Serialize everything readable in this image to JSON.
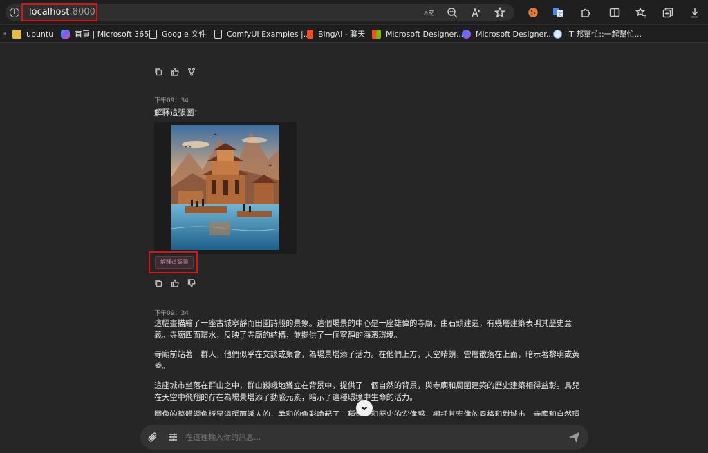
{
  "address_bar": {
    "host": "localhost",
    "port": ":8000"
  },
  "bookmarks": [
    {
      "label": "ubuntu",
      "icon": "folder-icon",
      "color": "#e8b84a"
    },
    {
      "label": "首頁 | Microsoft 365",
      "icon": "m365-icon",
      "color": "#7b5cf0"
    },
    {
      "label": "Google 文件",
      "icon": "page-icon",
      "color": "#d8d8d8"
    },
    {
      "label": "ComfyUI Examples |...",
      "icon": "page-icon",
      "color": "#d8d8d8"
    },
    {
      "label": "BingAI - 聊天",
      "icon": "bing-icon",
      "color": "#f25022"
    },
    {
      "label": "Microsoft Designer...",
      "icon": "microsoft-icon",
      "color": "#7fba00"
    },
    {
      "label": "Microsoft Designer...",
      "icon": "designer-icon",
      "color": "#9b59f5"
    },
    {
      "label": "iT 邦幫忙::一起幫忙...",
      "icon": "ithome-icon",
      "color": "#5aa0e6"
    }
  ],
  "chat": {
    "user_time": "下午09：34",
    "user_message": "解釋這張圖：",
    "image_tag": "解釋這張圖",
    "ai_time": "下午09：34",
    "ai_paragraphs": [
      "這幅畫描繪了一座古城寧靜而田園詩般的景象。這個場景的中心是一座雄偉的寺廟，由石頭建造，有幾層建築表明其歷史意義。寺廟四面環水，反映了寺廟的結構，並提供了一個寧靜的海濱環境。",
      "寺廟前站著一群人，他們似乎在交談或聚會，為場景增添了活力。在他們上方，天空晴朗，雲層散落在上面，暗示著黎明或黃昏。",
      "這座城市坐落在群山之中，群山巍峨地聳立在背景中，提供了一個自然的背景，與寺廟和周圍建築的歷史建築相得益彰。鳥兒在天空中飛翔的存在為場景增添了動感元素，暗示了這種環境中生命的活力。"
    ],
    "ai_cutoff_line": "圖像的整體調色板是溫暖而誘人的，柔和的色彩喚起了一種懷舊和歷史的安偉感，襯托其宏偉的風格和對城市、寺廟和自然環"
  },
  "composer": {
    "placeholder": "在這裡輸入你的訊息..."
  }
}
